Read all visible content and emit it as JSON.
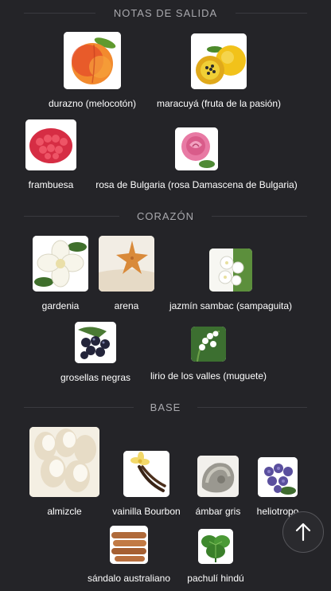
{
  "sections": [
    {
      "title": "NOTAS DE SALIDA",
      "notes": [
        {
          "label": "durazno (melocotón)",
          "icon": "peach-icon"
        },
        {
          "label": "maracuyá (fruta de la pasión)",
          "icon": "passion-fruit-icon"
        },
        {
          "label": "frambuesa",
          "icon": "raspberry-icon"
        },
        {
          "label": "rosa de Bulgaria (rosa Damascena de Bulgaria)",
          "icon": "rose-icon"
        }
      ]
    },
    {
      "title": "CORAZÓN",
      "notes": [
        {
          "label": "gardenia",
          "icon": "gardenia-icon"
        },
        {
          "label": "arena",
          "icon": "sand-starfish-icon"
        },
        {
          "label": "jazmín sambac (sampaguita)",
          "icon": "jasmine-icon"
        },
        {
          "label": "grosellas negras",
          "icon": "blackcurrant-icon"
        },
        {
          "label": "lirio de los valles (muguete)",
          "icon": "lily-of-the-valley-icon"
        }
      ]
    },
    {
      "title": "BASE",
      "notes": [
        {
          "label": "almizcle",
          "icon": "musk-icon"
        },
        {
          "label": "vainilla Bourbon",
          "icon": "vanilla-icon"
        },
        {
          "label": "ámbar gris",
          "icon": "ambergris-icon"
        },
        {
          "label": "heliotropo",
          "icon": "heliotrope-icon"
        },
        {
          "label": "sándalo australiano",
          "icon": "sandalwood-icon"
        },
        {
          "label": "pachulí hindú",
          "icon": "patchouli-icon"
        }
      ]
    }
  ],
  "scroll_top": {
    "icon": "arrow-up-icon"
  }
}
